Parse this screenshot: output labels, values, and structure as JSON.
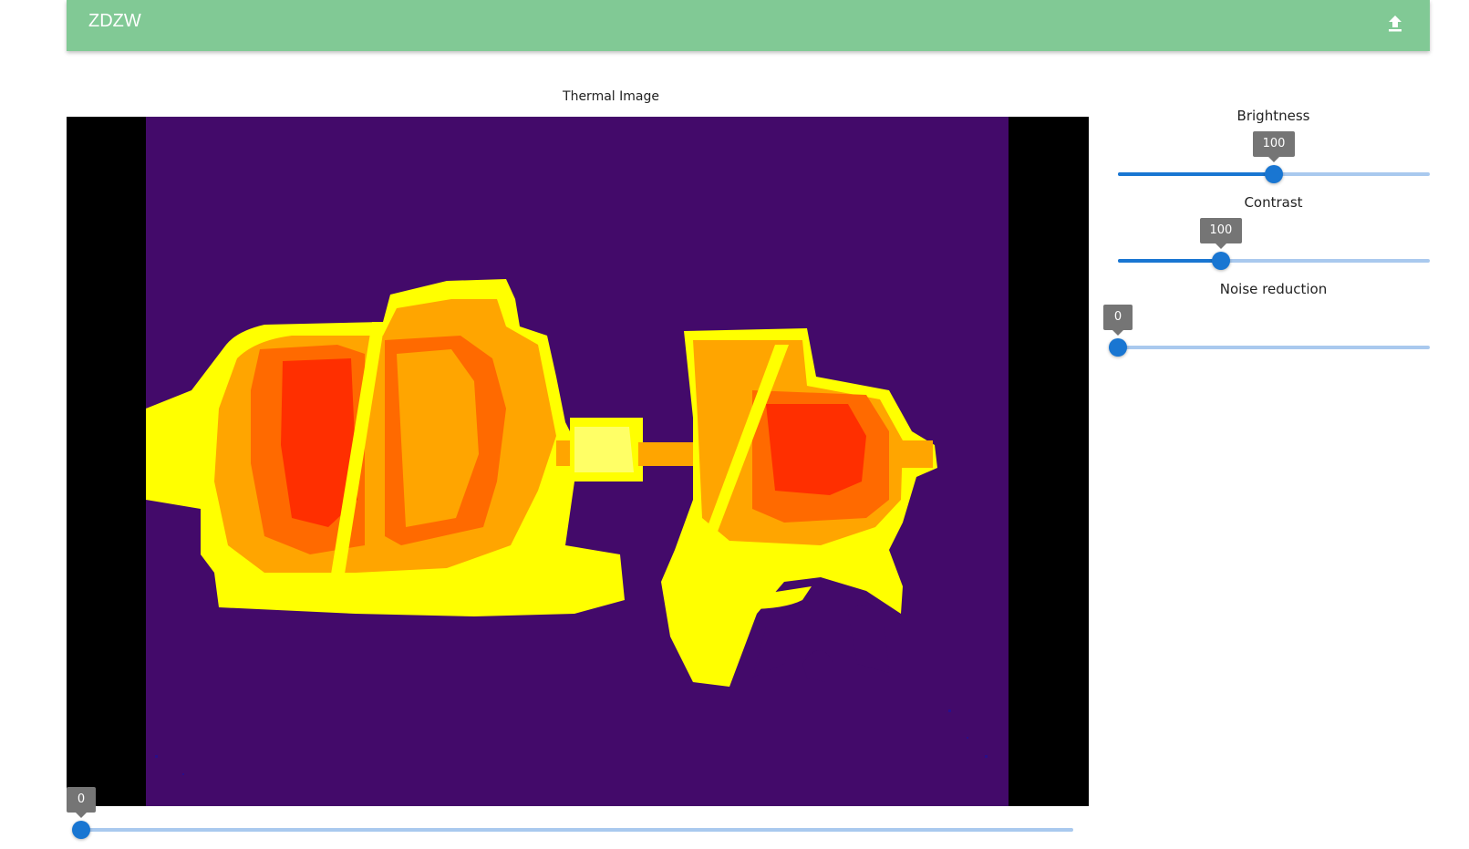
{
  "app": {
    "title": "ZDZW",
    "accent": "#81c995"
  },
  "toolbar": {
    "upload_icon": "upload-icon"
  },
  "viewer": {
    "title": "Thermal Image",
    "palette": [
      "#430a6a",
      "#ffff00",
      "#ffa500",
      "#ff6a00",
      "#ff2f00"
    ],
    "frame_slider": {
      "value": "0",
      "fraction": 0.0
    }
  },
  "controls": {
    "brightness": {
      "label": "Brightness",
      "value": "100",
      "fraction": 0.5
    },
    "contrast": {
      "label": "Contrast",
      "value": "100",
      "fraction": 0.33
    },
    "noise": {
      "label": "Noise reduction",
      "value": "0",
      "fraction": 0.0
    }
  }
}
